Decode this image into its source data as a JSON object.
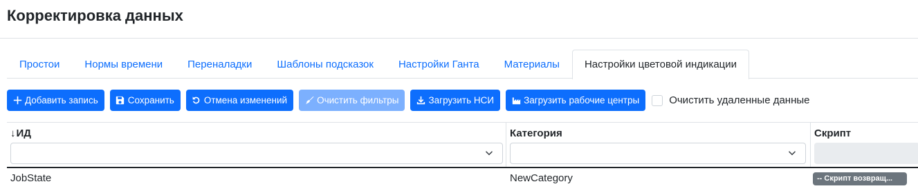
{
  "page": {
    "title": "Корректировка данных"
  },
  "tabs": [
    {
      "label": "Простои",
      "active": false
    },
    {
      "label": "Нормы времени",
      "active": false
    },
    {
      "label": "Переналадки",
      "active": false
    },
    {
      "label": "Шаблоны подсказок",
      "active": false
    },
    {
      "label": "Настройки Ганта",
      "active": false
    },
    {
      "label": "Материалы",
      "active": false
    },
    {
      "label": "Настройки цветовой индикации",
      "active": true
    }
  ],
  "toolbar": {
    "add_label": "Добавить запись",
    "save_label": "Сохранить",
    "cancel_label": "Отмена изменений",
    "clear_filters_label": "Очистить фильтры",
    "load_nsi_label": "Загрузить НСИ",
    "load_workcenters_label": "Загрузить рабочие центры",
    "clear_deleted_label": "Очистить удаленные данные",
    "clear_deleted_checked": false
  },
  "grid": {
    "columns": [
      {
        "label": "ИД",
        "sort": "desc",
        "sort_glyph": "↓"
      },
      {
        "label": "Категория"
      },
      {
        "label": "Скрипт"
      }
    ],
    "rows": [
      {
        "id": "JobState",
        "category": "NewCategory",
        "script": "-- Скрипт возвращ..."
      }
    ]
  },
  "colors": {
    "primary": "#0d6efd",
    "primary_disabled": "#6ea8fe",
    "badge": "#6c757d",
    "border": "#dee2e6"
  }
}
